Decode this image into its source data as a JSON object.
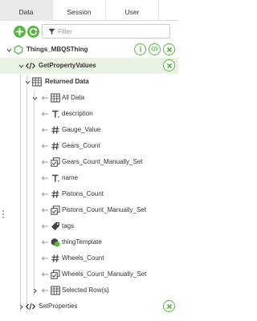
{
  "tabs": [
    {
      "label": "Data",
      "active": true
    },
    {
      "label": "Session",
      "active": false
    },
    {
      "label": "User",
      "active": false
    }
  ],
  "toolbar": {
    "filter_placeholder": "Filter"
  },
  "tree": {
    "thing": {
      "label": "Things_MBQSThing"
    },
    "service": {
      "label": "GetPropertyValues"
    },
    "returned_data": {
      "label": "Returned Data"
    },
    "all_data": {
      "label": "All Data"
    },
    "fields": [
      {
        "label": "description",
        "type_icon": "string-type-icon"
      },
      {
        "label": "Gauge_Value",
        "type_icon": "number-type-icon"
      },
      {
        "label": "Gears_Count",
        "type_icon": "number-type-icon"
      },
      {
        "label": "Gears_Count_Manually_Set",
        "type_icon": "boolean-type-icon"
      },
      {
        "label": "name",
        "type_icon": "string-type-icon"
      },
      {
        "label": "Pistons_Count",
        "type_icon": "number-type-icon"
      },
      {
        "label": "Pistons_Count_Manually_Set",
        "type_icon": "boolean-type-icon"
      },
      {
        "label": "tags",
        "type_icon": "tag-type-icon"
      },
      {
        "label": "thingTemplate",
        "type_icon": "thing-template-type-icon"
      },
      {
        "label": "Wheels_Count",
        "type_icon": "number-type-icon"
      },
      {
        "label": "Wheels_Count_Manually_Set",
        "type_icon": "boolean-type-icon"
      }
    ],
    "selected_rows": {
      "label": "Selected Row(s)"
    },
    "set_properties": {
      "label": "SetProperties"
    }
  },
  "colors": {
    "accent": "#5bb544",
    "highlight": "#eaf3e2",
    "active_tab": "#e9e9e9"
  }
}
